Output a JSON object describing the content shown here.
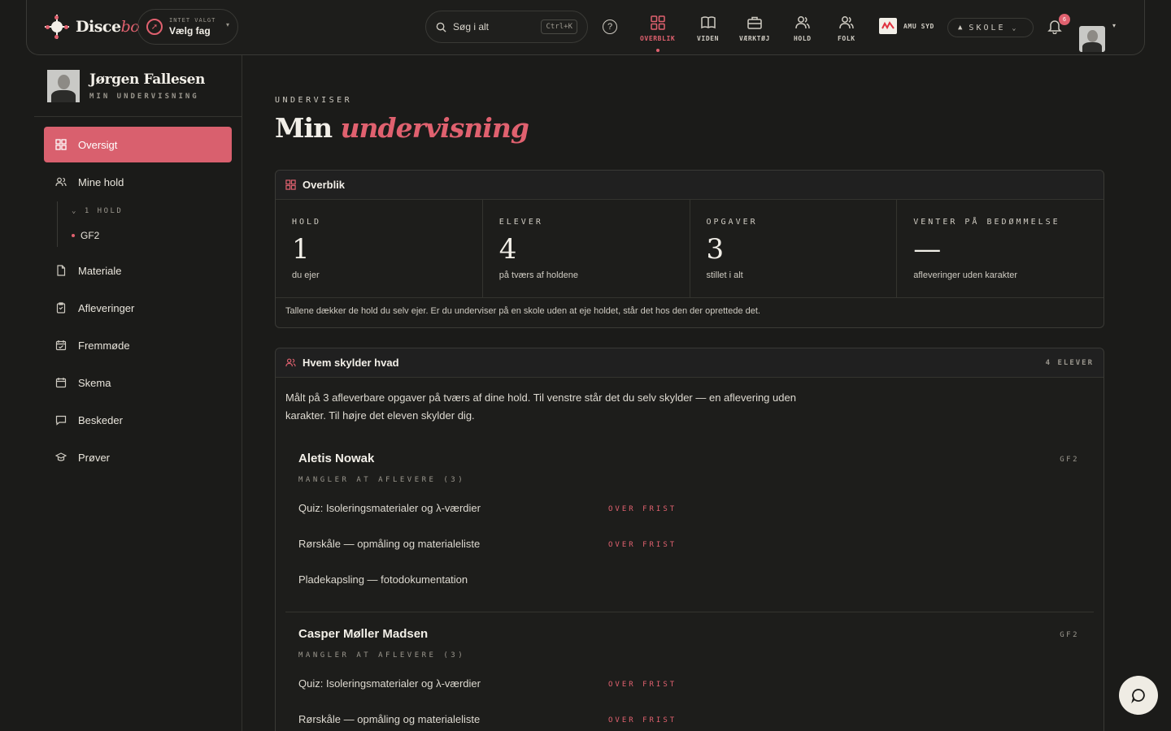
{
  "brand": {
    "name_a": "Disce",
    "name_b": "bo"
  },
  "subject": {
    "hint": "INTET VALGT",
    "label": "Vælg fag"
  },
  "search": {
    "placeholder": "Søg i alt",
    "shortcut": "Ctrl+K"
  },
  "nav": [
    {
      "label": "OVERBLIK",
      "icon": "grid-icon",
      "active": true
    },
    {
      "label": "VIDEN",
      "icon": "book-icon"
    },
    {
      "label": "VÆRKTØJ",
      "icon": "briefcase-icon"
    },
    {
      "label": "HOLD",
      "icon": "team-icon"
    },
    {
      "label": "FOLK",
      "icon": "people-icon"
    }
  ],
  "school": {
    "name": "AMU SYD",
    "switcher": "SKOLE"
  },
  "notifications": {
    "count": "6"
  },
  "colors": {
    "accent": "#e0616f",
    "background": "#1b1b19",
    "surface": "#1d1d1b",
    "text": "#e9e5dc"
  },
  "profile": {
    "name": "Jørgen Fallesen",
    "role": "MIN UNDERVISNING"
  },
  "sidebar": {
    "items": [
      {
        "label": "Oversigt",
        "icon": "dashboard-icon",
        "active": true
      },
      {
        "label": "Mine hold",
        "icon": "users-icon"
      },
      {
        "label": "Materiale",
        "icon": "file-icon"
      },
      {
        "label": "Afleveringer",
        "icon": "clipboard-icon"
      },
      {
        "label": "Fremmøde",
        "icon": "calendar-check-icon"
      },
      {
        "label": "Skema",
        "icon": "calendar-icon"
      },
      {
        "label": "Beskeder",
        "icon": "message-icon"
      },
      {
        "label": "Prøver",
        "icon": "graduation-icon"
      }
    ],
    "hold_count": "1 HOLD",
    "hold_items": [
      "GF2"
    ]
  },
  "page": {
    "eyebrow": "UNDERVISER",
    "title_a": "Min",
    "title_b": "undervisning"
  },
  "overview": {
    "title": "Overblik",
    "stats": [
      {
        "label": "HOLD",
        "value": "1",
        "caption": "du ejer"
      },
      {
        "label": "ELEVER",
        "value": "4",
        "caption": "på tværs af holdene"
      },
      {
        "label": "OPGAVER",
        "value": "3",
        "caption": "stillet i alt"
      },
      {
        "label": "VENTER PÅ BEDØMMELSE",
        "value": "—",
        "caption": "afleveringer uden karakter"
      }
    ],
    "note": "Tallene dækker de hold du selv ejer. Er du underviser på en skole uden at eje holdet, står det hos den der oprettede det."
  },
  "owes": {
    "title": "Hvem skylder hvad",
    "count": "4 ELEVER",
    "intro": "Målt på 3 afleverbare opgaver på tværs af dine hold. Til venstre står det du selv skylder — en aflevering uden karakter. Til højre det eleven skylder dig.",
    "students": [
      {
        "name": "Aletis Nowak",
        "group": "GF2",
        "missing": "MANGLER AT AFLEVERE (3)",
        "tasks": [
          {
            "title": "Quiz: Isoleringsmaterialer og λ-værdier",
            "status": "OVER FRIST"
          },
          {
            "title": "Rørskåle — opmåling og materialeliste",
            "status": "OVER FRIST"
          },
          {
            "title": "Pladekapsling — fotodokumentation",
            "status": ""
          }
        ]
      },
      {
        "name": "Casper Møller Madsen",
        "group": "GF2",
        "missing": "MANGLER AT AFLEVERE (3)",
        "tasks": [
          {
            "title": "Quiz: Isoleringsmaterialer og λ-værdier",
            "status": "OVER FRIST"
          },
          {
            "title": "Rørskåle — opmåling og materialeliste",
            "status": "OVER FRIST"
          }
        ]
      }
    ]
  }
}
